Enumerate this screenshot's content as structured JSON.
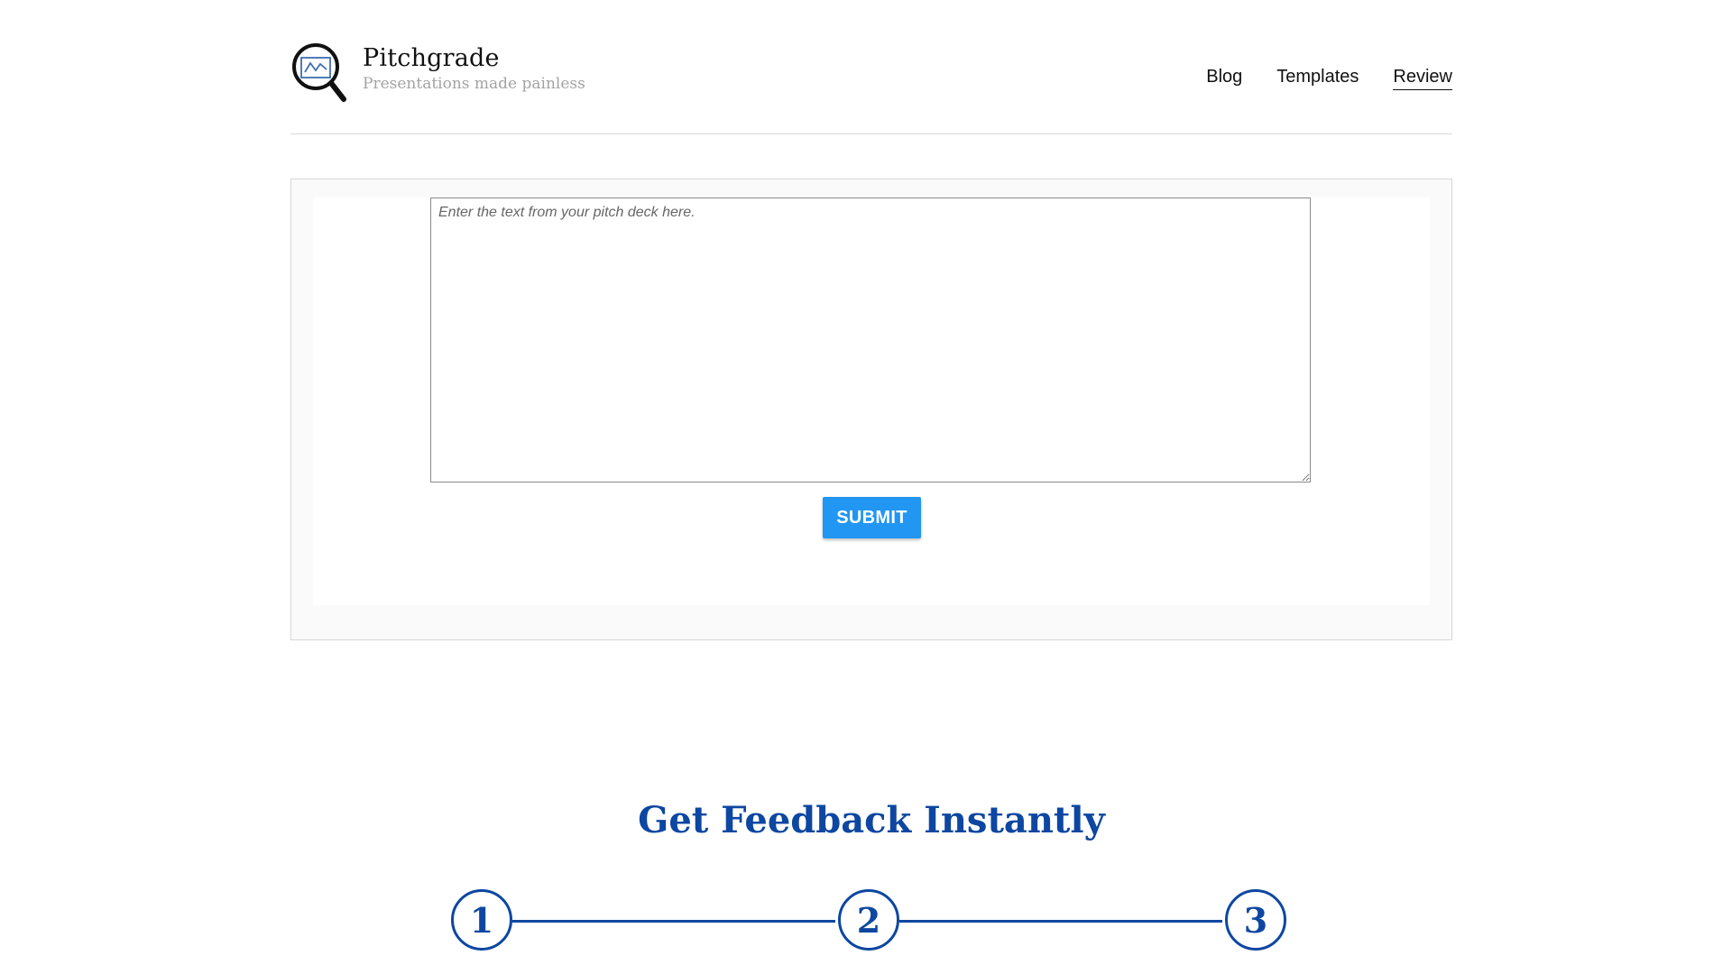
{
  "brand": {
    "title": "Pitchgrade",
    "tagline": "Presentations made painless",
    "logo_icon": "magnifier-chart-icon"
  },
  "nav": {
    "items": [
      {
        "label": "Blog",
        "active": false
      },
      {
        "label": "Templates",
        "active": false
      },
      {
        "label": "Review",
        "active": true
      }
    ]
  },
  "form": {
    "placeholder": "Enter the text from your pitch deck here.",
    "value": "",
    "submit_label": "SUBMIT"
  },
  "feedback": {
    "title": "Get Feedback Instantly",
    "steps": [
      "1",
      "2",
      "3"
    ]
  },
  "colors": {
    "accent": "#2196f3",
    "heading_blue": "#0d47a1",
    "tagline_gray": "#a3a3a3"
  }
}
